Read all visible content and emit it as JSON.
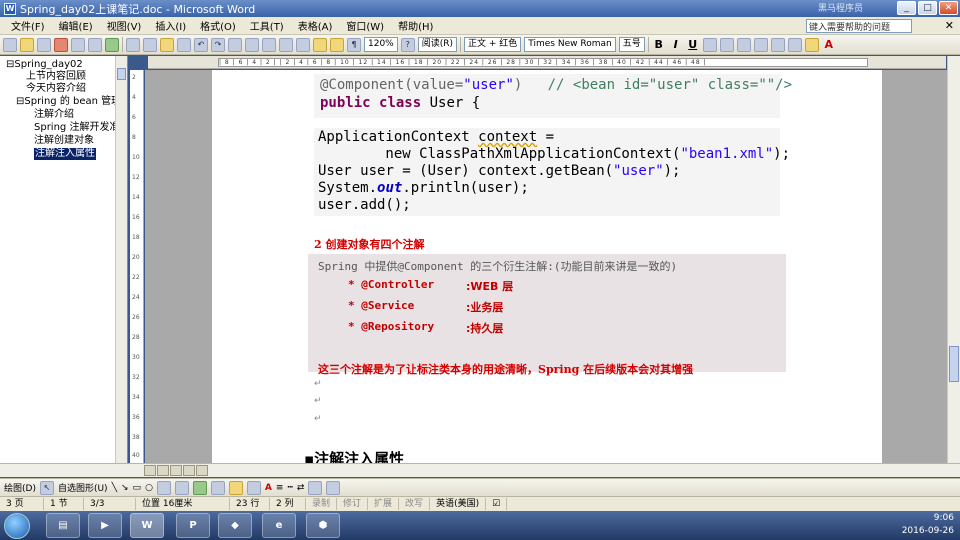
{
  "window": {
    "title": "Spring_day02上课笔记.doc - Microsoft Word",
    "watermark": "黑马程序员"
  },
  "menu": {
    "items": [
      "文件(F)",
      "编辑(E)",
      "视图(V)",
      "插入(I)",
      "格式(O)",
      "工具(T)",
      "表格(A)",
      "窗口(W)",
      "帮助(H)"
    ],
    "help_box": "键入需要帮助的问题"
  },
  "toolbar": {
    "zoom": "120%",
    "read_button": "阅读(R)",
    "style": "正文 + 红色",
    "font": "Times New Roman",
    "size": "五号",
    "bold": "B",
    "italic": "I",
    "underline": "U",
    "font_color": "A"
  },
  "outline": {
    "items": [
      {
        "label": "⊟Spring_day02",
        "indent": 0
      },
      {
        "label": "上节内容回顾",
        "indent": 2
      },
      {
        "label": "今天内容介绍",
        "indent": 2
      },
      {
        "label": "⊟Spring 的 bean 管理",
        "indent": 1
      },
      {
        "label": "注解介绍",
        "indent": 3
      },
      {
        "label": "Spring 注解开发准",
        "indent": 3
      },
      {
        "label": "注解创建对象",
        "indent": 3
      },
      {
        "label": "注解注入属性",
        "indent": 3,
        "selected": true
      }
    ]
  },
  "ruler": {
    "h": "| 8 | 6 | 4 | 2 |  | 2 | 4 | 6 | 8 | 10 | 12 | 14 | 16 | 18 | 20 | 22 | 24 | 26 | 28 | 30 | 32 | 34 | 36 | 38 | 40 | 42 | 44 | 46 | 48 |",
    "v": [
      "2",
      "4",
      "6",
      "8",
      "10",
      "12",
      "14",
      "16",
      "18",
      "20",
      "22",
      "24",
      "26",
      "28",
      "30",
      "32",
      "34",
      "36",
      "38",
      "40"
    ]
  },
  "document": {
    "code1": {
      "line1_anno": "@Component(value=",
      "line1_str": "\"user\"",
      "line1_close": ")",
      "line1_comment": "// <bean id=\"user\" class=\"\"/>",
      "line2_kw1": "public",
      "line2_kw2": "class",
      "line2_rest": "User {"
    },
    "code2": {
      "l1a": "ApplicationContext ",
      "l1b": "context",
      "l1c": " =",
      "l2a": "        new ClassPathXmlApplicationContext(",
      "l2b": "\"bean1.xml\"",
      "l2c": ");",
      "l3a": "User ",
      "l3b": "user",
      "l3c": " = (User) ",
      "l3d": "context",
      "l3e": ".getBean(",
      "l3f": "\"user\"",
      "l3g": ");",
      "l4a": "System.",
      "l4b": "out",
      "l4c": ".println(",
      "l4d": "user",
      "l4e": ");",
      "l5a": "user",
      "l5b": ".add();"
    },
    "section_title": "2  创建对象有四个注解",
    "intro": "Spring 中提供@Component 的三个衍生注解:(功能目前来讲是一致的)",
    "bullets": [
      {
        "code": "* @Controller",
        "desc": ":WEB 层"
      },
      {
        "code": "* @Service",
        "desc": ":业务层"
      },
      {
        "code": "* @Repository",
        "desc": ":持久层"
      }
    ],
    "note": "这三个注解是为了让标注类本身的用途清晰，Spring 在后续版本会对其增强",
    "heading": "▪注解注入属性"
  },
  "drawbar": {
    "draw": "绘图(D)",
    "autoshape": "自选图形(U)"
  },
  "status": {
    "page": "3 页",
    "section": "1 节",
    "pages": "3/3",
    "position": "位置 16厘米",
    "line": "23 行",
    "col": "2 列",
    "rec": "录制",
    "trk": "修订",
    "ext": "扩展",
    "ovr": "改写",
    "lang": "英语(美国)"
  },
  "taskbar": {
    "time": "9:06",
    "date": "2016-09-26"
  }
}
